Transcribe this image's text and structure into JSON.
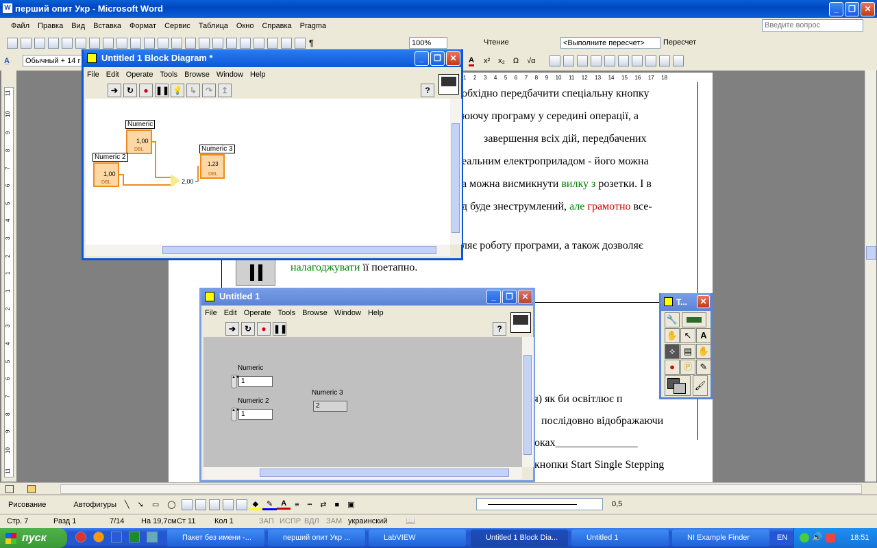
{
  "word": {
    "title": "перший опит Укр - Microsoft Word",
    "menu": [
      "Файл",
      "Правка",
      "Вид",
      "Вставка",
      "Формат",
      "Сервис",
      "Таблица",
      "Окно",
      "Справка",
      "Pragma"
    ],
    "help_placeholder": "Введите вопрос",
    "zoom": "100%",
    "reading_label": "Чтение",
    "recalc_dropdown": "<Выполните пересчет>",
    "recalc_button": "Пересчет",
    "style_value": "Обычный + 14 г",
    "ruler_numbers": [
      "1",
      "2",
      "3",
      "4",
      "5",
      "6",
      "7",
      "8",
      "9",
      "10",
      "11",
      "12",
      "13",
      "14",
      "15",
      "16",
      "17",
      "18"
    ],
    "vruler_numbers": [
      "11",
      "10",
      "9",
      "8",
      "7",
      "6",
      "5",
      "4",
      "3",
      "2",
      "1",
      "1",
      "2",
      "3",
      "4",
      "5",
      "6",
      "7",
      "8",
      "9",
      "10",
      "11"
    ],
    "doc_lines": [
      "обхідно передбачити спеціальну кнопку",
      "юючу програму у середині операції, а",
      "завершення  всіх  дій, передбачених",
      "еальним електроприладом - його можна",
      "а можна висмикнути",
      "д буде знеструмлений,",
      "ляє  роботу  програми,  а  також  дозволяє",
      "її поетапно.",
      "ія)  як  би  освітлює  п",
      "послідовно   відображаючи",
      "оках_______________",
      "кнопки Start Single Stepping"
    ],
    "green_words": [
      "вилку з",
      "але",
      "налагоджувати"
    ],
    "red_words": [
      "грамотно"
    ],
    "after_words": [
      " розетки. І в",
      " все-"
    ],
    "drawing_label": "Рисование",
    "autoshapes_label": "Автофигуры",
    "line_width": "0,5",
    "status": {
      "page": "Стр. 7",
      "section": "Разд 1",
      "pages": "7/14",
      "at": "На 19,7см",
      "line": "Ст 11",
      "col": "Кол 1",
      "rec": "ЗАП",
      "trk": "ИСПР",
      "ext": "ВДЛ",
      "ovr": "ЗАМ",
      "lang": "украинский"
    }
  },
  "block_diagram": {
    "title": "Untitled 1 Block Diagram *",
    "menu": [
      "File",
      "Edit",
      "Operate",
      "Tools",
      "Browse",
      "Window",
      "Help"
    ],
    "nodes": {
      "numeric": {
        "label": "Numeric",
        "value": "1,00",
        "type": "DBL"
      },
      "numeric2": {
        "label": "Numeric 2",
        "value": "1,00",
        "type": "DBL"
      },
      "numeric3": {
        "label": "Numeric 3",
        "value": "1.23",
        "type": "DBL"
      },
      "add_result": "2,00"
    }
  },
  "front_panel": {
    "title": "Untitled 1",
    "menu": [
      "File",
      "Edit",
      "Operate",
      "Tools",
      "Browse",
      "Window",
      "Help"
    ],
    "controls": {
      "numeric": {
        "label": "Numeric",
        "value": "1"
      },
      "numeric2": {
        "label": "Numeric 2",
        "value": "1"
      },
      "numeric3": {
        "label": "Numeric 3",
        "value": "2"
      }
    }
  },
  "tools_palette": {
    "title": "T..."
  },
  "taskbar": {
    "start": "пуск",
    "tasks": [
      "Пакет без имени -...",
      "перший опит Укр ...",
      "LabVIEW",
      "Untitled 1 Block Dia...",
      "Untitled 1",
      "NI Example Finder"
    ],
    "lang": "EN",
    "clock": "18:51"
  },
  "colors": {
    "accent": "#0a55d8",
    "wire": "#f08a1e",
    "green_text": "#008000",
    "red_text": "#cc0000"
  }
}
